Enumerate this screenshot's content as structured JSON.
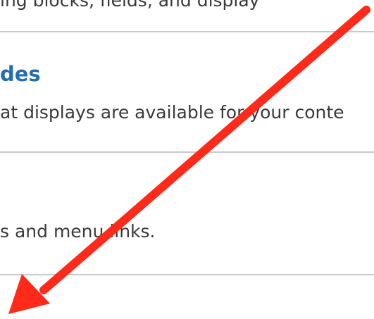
{
  "items": [
    {
      "description_tail": "ing blocks, fields, and display"
    },
    {
      "title_tail": "des",
      "description_tail": "at displays are available for your conte"
    },
    {
      "description_tail": "s and menu links."
    }
  ],
  "annotation": {
    "arrow_icon": "red-arrow-icon",
    "color": "#ff2a1a"
  }
}
